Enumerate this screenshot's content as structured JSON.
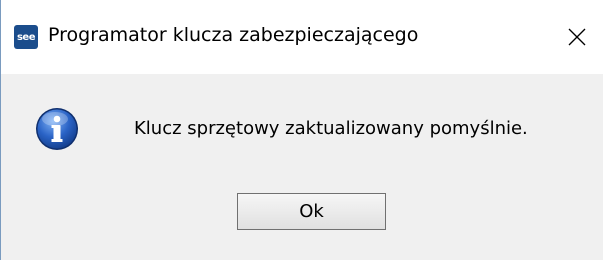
{
  "window": {
    "title": "Programator klucza zabezpieczającego",
    "app_icon_text": "see",
    "close_glyph": "×"
  },
  "dialog": {
    "icon": "info-icon",
    "message": "Klucz sprzętowy zaktualizowany pomyślnie.",
    "ok_label": "Ok"
  },
  "colors": {
    "titlebar_bg": "#ffffff",
    "body_bg": "#f0f0f0",
    "app_icon_bg": "#1b4d8c",
    "info_icon_blue": "#1f57b8"
  }
}
